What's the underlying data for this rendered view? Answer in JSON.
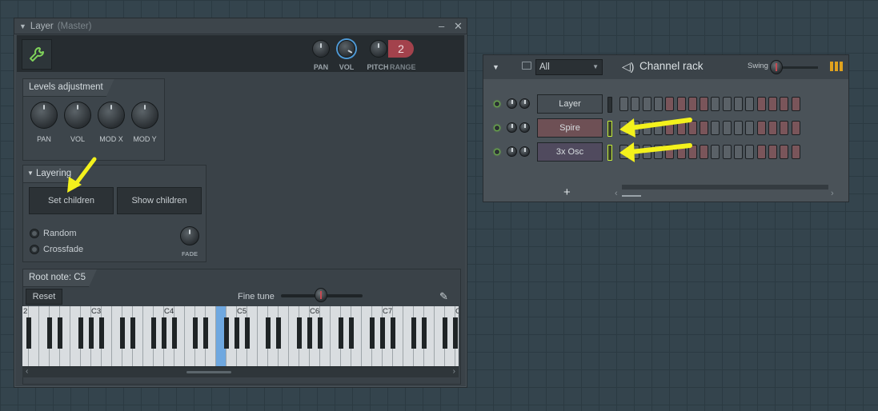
{
  "layer_window": {
    "title": "Layer",
    "title_suffix": "(Master)",
    "controls": {
      "minimize": "–",
      "close": "✕"
    },
    "toolbar": {
      "knobs": [
        {
          "label": "PAN"
        },
        {
          "label": "VOL"
        },
        {
          "label": "PITCH"
        }
      ],
      "range_value": "2",
      "range_label": "RANGE"
    },
    "levels_adjustment": {
      "title": "Levels adjustment",
      "knobs": [
        {
          "label": "PAN"
        },
        {
          "label": "VOL"
        },
        {
          "label": "MOD X"
        },
        {
          "label": "MOD Y"
        }
      ]
    },
    "layering": {
      "title": "Layering",
      "set_children": "Set children",
      "show_children": "Show children",
      "options": [
        "Random",
        "Crossfade"
      ],
      "fade_label": "FADE"
    },
    "root_note": {
      "title": "Root note: C5",
      "reset": "Reset",
      "fine_tune": "Fine tune"
    },
    "piano": {
      "octave_labels": [
        "2",
        "C3",
        "C4",
        "C5",
        "C6",
        "C7",
        "C"
      ],
      "highlighted": "C5"
    }
  },
  "channel_rack": {
    "filter_value": "All",
    "title": "Channel rack",
    "swing_label": "Swing",
    "channels": [
      {
        "name": "Layer",
        "color": "#454d53"
      },
      {
        "name": "Spire",
        "color": "#6e5055"
      },
      {
        "name": "3x Osc",
        "color": "#504a5e"
      }
    ],
    "add_label": "+"
  },
  "colors": {
    "accent_green": "#7fd35a",
    "highlight_blue": "#6fa8e0",
    "arrow_yellow": "#f3f11c",
    "step_dark": "#5a6167",
    "step_red": "#7a555a"
  }
}
